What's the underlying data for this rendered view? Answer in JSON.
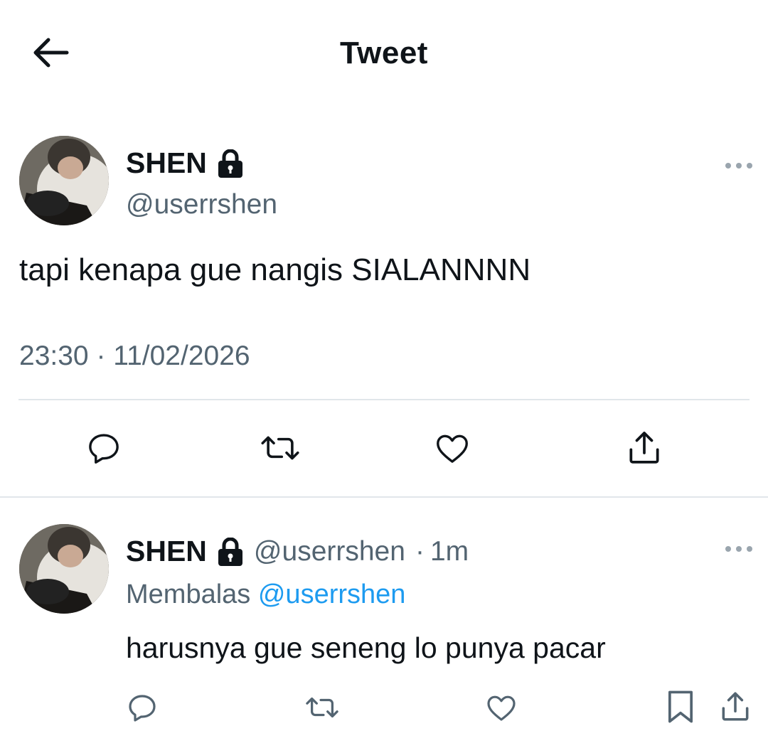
{
  "header": {
    "title": "Tweet",
    "back_icon": "arrow-left-icon"
  },
  "main_tweet": {
    "display_name": "SHEN",
    "handle": "@userrshen",
    "text": "tapi kenapa gue nangis SIALANNNN",
    "time": "23:30",
    "separator": "·",
    "date": "11/02/2026",
    "actions": [
      "reply-icon",
      "retweet-icon",
      "like-icon",
      "share-icon"
    ]
  },
  "reply_tweet": {
    "display_name": "SHEN",
    "handle": "@userrshen",
    "separator": "·",
    "age": "1m",
    "replying_label": "Membalas",
    "replying_to": "@userrshen",
    "text": "harusnya gue seneng lo punya pacar",
    "actions": [
      "reply-icon",
      "retweet-icon",
      "like-icon",
      "bookmark-icon",
      "share-icon"
    ]
  },
  "colors": {
    "text": "#0f1419",
    "secondary": "#536471",
    "link": "#1d9bf0",
    "divider": "#e1e6ea"
  }
}
